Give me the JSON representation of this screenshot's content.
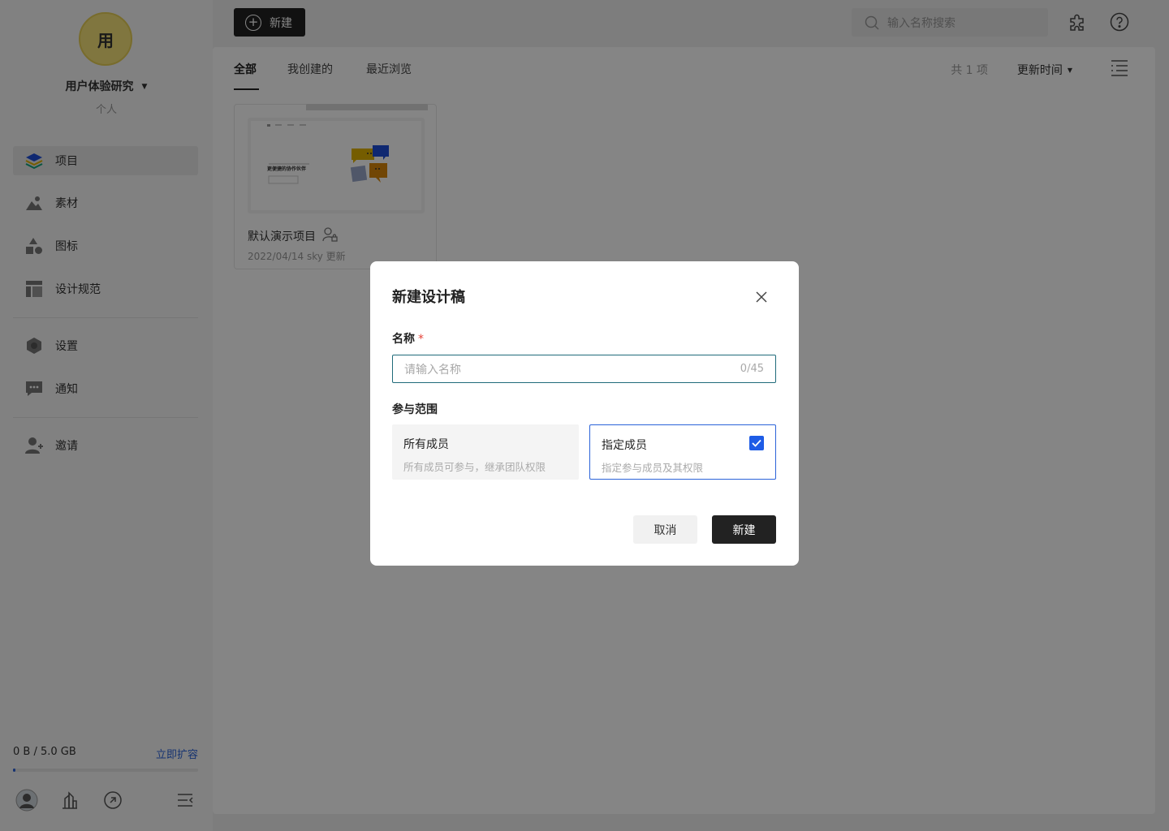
{
  "team": {
    "avatar_text": "用",
    "name": "用户体验研究",
    "type": "个人"
  },
  "nav": {
    "items": [
      {
        "label": "项目",
        "icon": "layers-icon",
        "active": true
      },
      {
        "label": "素材",
        "icon": "image-icon",
        "active": false
      },
      {
        "label": "图标",
        "icon": "shapes-icon",
        "active": false
      },
      {
        "label": "设计规范",
        "icon": "layout-icon",
        "active": false
      },
      {
        "label": "设置",
        "icon": "gear-icon",
        "active": false
      },
      {
        "label": "通知",
        "icon": "message-icon",
        "active": false
      },
      {
        "label": "邀请",
        "icon": "add-user-icon",
        "active": false
      }
    ]
  },
  "storage": {
    "usage_text": "0 B / 5.0 GB",
    "upgrade_label": "立即扩容",
    "used_fraction": 0.0
  },
  "topbar": {
    "new_label": "新建",
    "search_placeholder": "输入名称搜索"
  },
  "main": {
    "tabs": [
      {
        "label": "全部",
        "active": true
      },
      {
        "label": "我创建的",
        "active": false
      },
      {
        "label": "最近浏览",
        "active": false
      }
    ],
    "count_text": "共 1 项",
    "sort_label": "更新时间"
  },
  "project_card": {
    "title": "默认演示项目",
    "meta": "2022/04/14 sky 更新",
    "thumb_text": "更便捷的协作伙伴"
  },
  "dialog": {
    "title": "新建设计稿",
    "name_label": "名称",
    "required_mark": "*",
    "name_placeholder": "请输入名称",
    "name_counter": "0/45",
    "scope_label": "参与范围",
    "options": [
      {
        "title": "所有成员",
        "desc": "所有成员可参与，继承团队权限",
        "selected": false
      },
      {
        "title": "指定成员",
        "desc": "指定参与成员及其权限",
        "selected": true
      }
    ],
    "cancel_label": "取消",
    "create_label": "新建"
  },
  "colors": {
    "accent": "#1e5ce6",
    "link": "#2b63d9",
    "dark": "#222222",
    "avatar": "#f5e27a",
    "required": "#e5443a"
  }
}
